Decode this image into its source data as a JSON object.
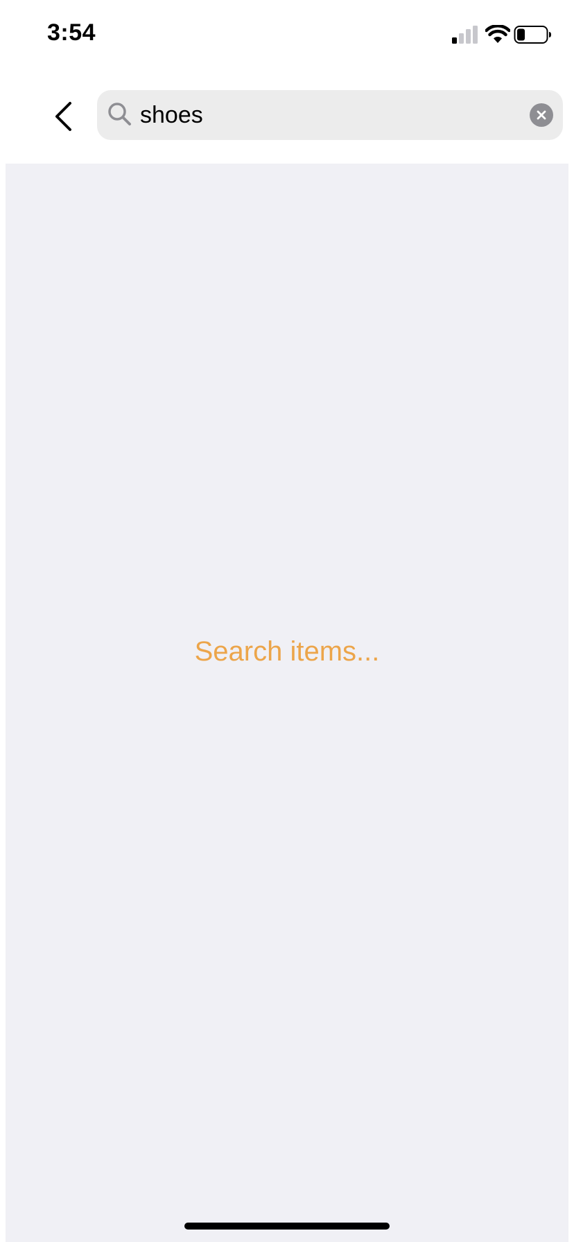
{
  "status_bar": {
    "time": "3:54"
  },
  "header": {
    "search": {
      "value": "shoes"
    }
  },
  "main": {
    "empty_state_text": "Search items..."
  },
  "colors": {
    "accent": "#eca54a",
    "content_background": "#f0f0f5",
    "search_field_background": "#ececec"
  },
  "icons": {
    "back": "chevron-left-icon",
    "search": "magnifying-glass-icon",
    "clear": "close-circle-icon"
  }
}
